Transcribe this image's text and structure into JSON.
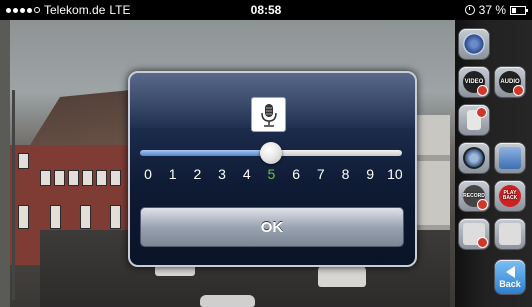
{
  "status_bar": {
    "carrier": "Telekom.de",
    "network": "LTE",
    "time": "08:58",
    "battery": "37 %"
  },
  "toolbar": {
    "buttons": [
      {
        "name": "settings",
        "label": ""
      },
      {
        "name": "video",
        "label": "VIDEO"
      },
      {
        "name": "audio",
        "label": "AUDIO"
      },
      {
        "name": "device",
        "label": ""
      },
      {
        "name": "snapshot",
        "label": ""
      },
      {
        "name": "gallery",
        "label": ""
      },
      {
        "name": "record",
        "label": "RECORD"
      },
      {
        "name": "playback",
        "label": "PLAY BACK"
      },
      {
        "name": "talk",
        "label": ""
      },
      {
        "name": "mic",
        "label": ""
      },
      {
        "name": "back",
        "label": "Back"
      }
    ]
  },
  "dialog": {
    "slider": {
      "min": 0,
      "max": 10,
      "value": 5,
      "ticks": [
        "0",
        "1",
        "2",
        "3",
        "4",
        "5",
        "6",
        "7",
        "8",
        "9",
        "10"
      ]
    },
    "ok_label": "OK"
  },
  "colors": {
    "dialog_bg": "#0e1a33",
    "tick_active": "#6cc04a",
    "slider_fill": "#4f86d1"
  }
}
